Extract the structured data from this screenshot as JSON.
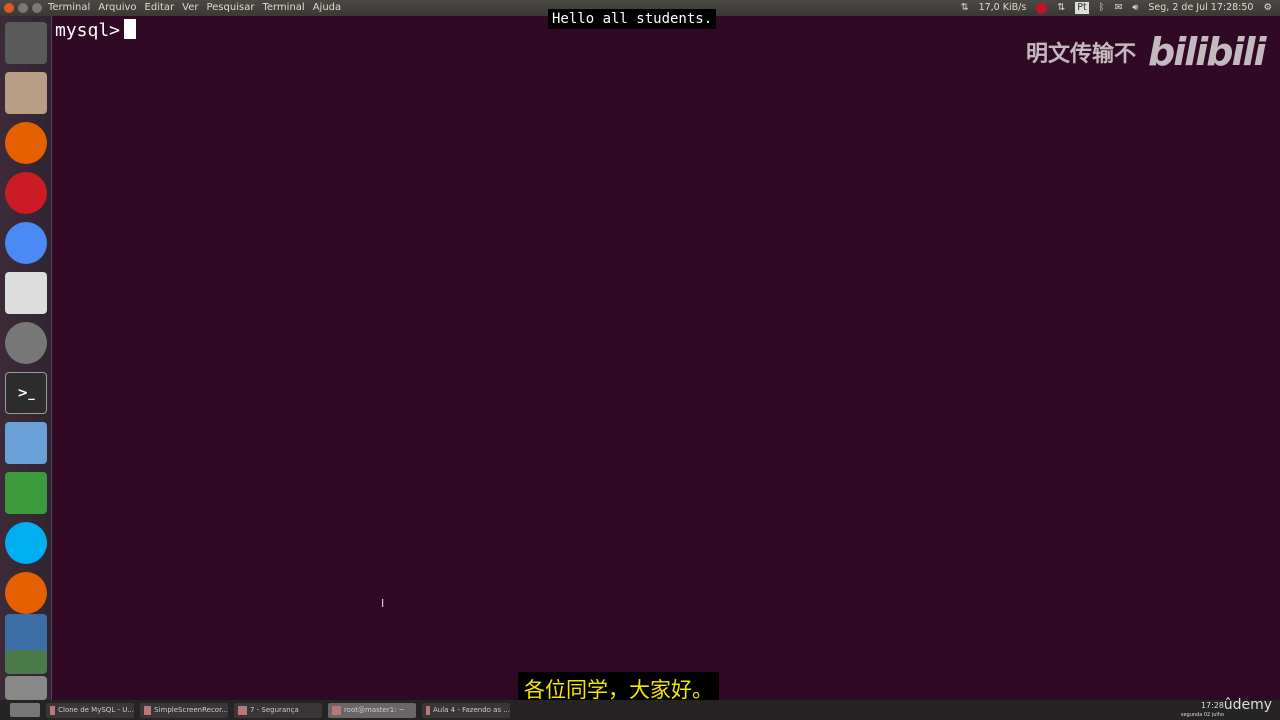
{
  "topbar": {
    "menu": [
      "Terminal",
      "Arquivo",
      "Editar",
      "Ver",
      "Pesquisar",
      "Terminal",
      "Ajuda"
    ],
    "net_speed": "17,0 KiB/s",
    "datetime": "Seg, 2 de Jul 17:28:50"
  },
  "launcher": [
    {
      "name": "ubuntu-dash-icon",
      "color": "#5a5a5a"
    },
    {
      "name": "files-icon",
      "color": "#b89e86"
    },
    {
      "name": "firefox-icon",
      "color": "#e66000"
    },
    {
      "name": "opera-icon",
      "color": "#cc1b24"
    },
    {
      "name": "chrome-icon",
      "color": "#4a8af4"
    },
    {
      "name": "text-editor-icon",
      "color": "#ddd"
    },
    {
      "name": "rhythmbox-icon",
      "color": "#777"
    },
    {
      "name": "terminal-icon",
      "color": "#2c2c2c"
    },
    {
      "name": "image-viewer-icon",
      "color": "#6aa0d8"
    },
    {
      "name": "spreadsheet-icon",
      "color": "#3b9a3b"
    },
    {
      "name": "skype-icon",
      "color": "#00aff0"
    },
    {
      "name": "firefox-2-icon",
      "color": "#e66000"
    },
    {
      "name": "virtualbox-icon",
      "color": "#3a6ea5"
    },
    {
      "name": "workspace-icon",
      "color": "#4a7a4a"
    },
    {
      "name": "trash-icon",
      "color": "#888"
    }
  ],
  "terminal": {
    "prompt": "mysql>"
  },
  "subtitles": {
    "top": "Hello all students.",
    "bottom": "各位同学，大家好。"
  },
  "watermark": {
    "text": "明文传输不",
    "logo": "bilibili"
  },
  "taskbar": {
    "tasks": [
      "Clone de MySQL - U...",
      "SimpleScreenRecor...",
      "7 - Segurança",
      "root@master1: ~",
      "Aula 4 - Fazendo as ..."
    ],
    "active_index": 3,
    "time": "17:28",
    "date": "segunda 02 julho",
    "brand": "ûdemy"
  }
}
